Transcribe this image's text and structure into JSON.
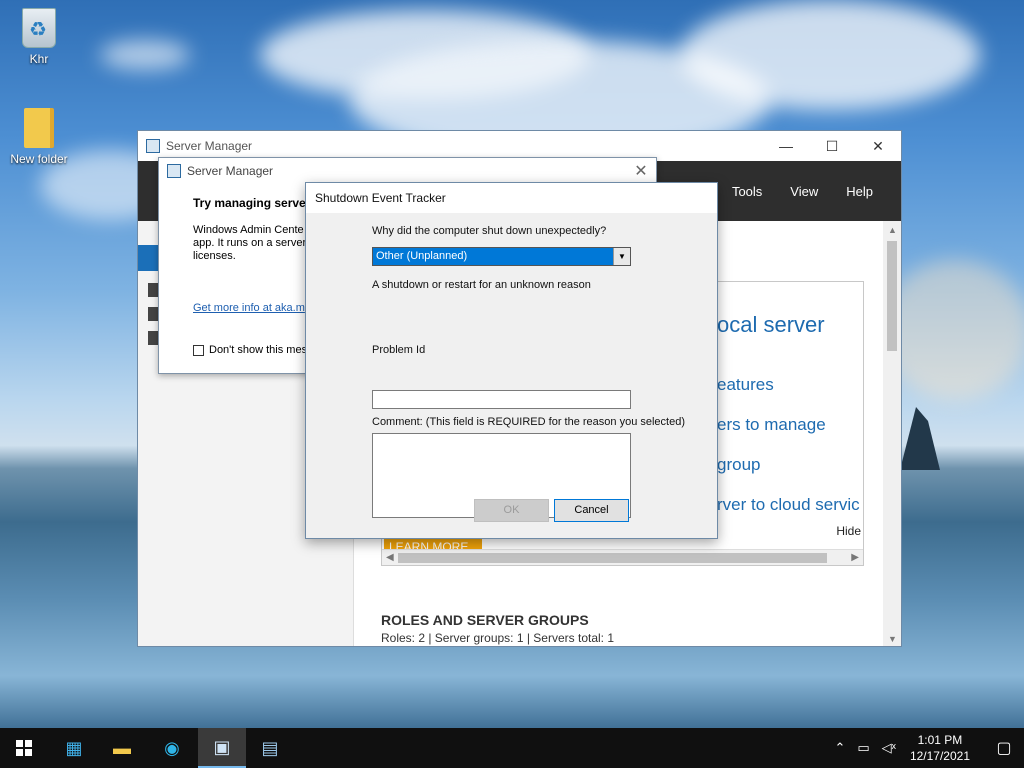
{
  "desktop": {
    "icons": [
      {
        "label": "Khr"
      },
      {
        "label": "New folder"
      }
    ]
  },
  "server_manager": {
    "title": "Server Manager",
    "menus": [
      "Tools",
      "View",
      "Help"
    ],
    "welcome": {
      "title_partial": "ocal server",
      "links_partial": [
        "eatures",
        "ers to manage",
        "group",
        "rver to cloud servic"
      ],
      "hide_label": "Hide",
      "learn_more": "LEARN MORE"
    },
    "roles": {
      "title": "ROLES AND SERVER GROUPS",
      "summary": "Roles: 2   |   Server groups: 1   |   Servers total: 1"
    }
  },
  "popup": {
    "title": "Server Manager",
    "heading_partial": "Try managing serve",
    "description_lines": [
      "Windows Admin Cente",
      "app. It runs on a server",
      "licenses."
    ],
    "link_partial": "Get more info at aka.m",
    "checkbox_label_partial": "Don't show this mes"
  },
  "shutdown_dialog": {
    "title": "Shutdown Event Tracker",
    "question": "Why did the computer shut down unexpectedly?",
    "selected_reason": "Other (Unplanned)",
    "reason_description": "A shutdown or restart for an unknown reason",
    "problem_id_label": "Problem Id",
    "problem_id_value": "",
    "comment_label": "Comment: (This field is REQUIRED for the reason you selected)",
    "comment_value": "",
    "ok_label": "OK",
    "cancel_label": "Cancel"
  },
  "taskbar": {
    "time": "1:01 PM",
    "date": "12/17/2021"
  }
}
